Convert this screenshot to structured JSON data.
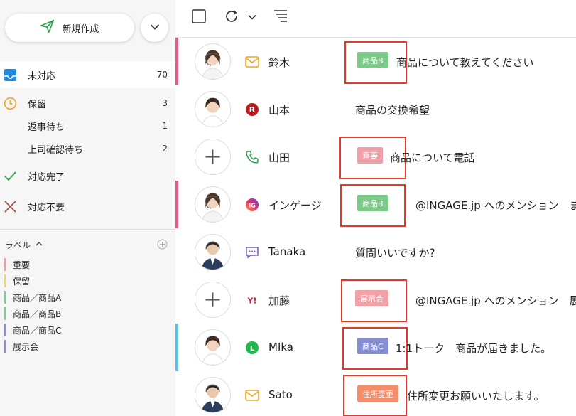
{
  "sidebar": {
    "compose_label": "新規作成",
    "nav": [
      {
        "label": "未対応",
        "count": "70"
      },
      {
        "label": "保留",
        "count": "3"
      },
      {
        "label": "返事待ち",
        "count": "1"
      },
      {
        "label": "上司確認待ち",
        "count": "2"
      },
      {
        "label": "対応完了",
        "count": ""
      },
      {
        "label": "対応不要",
        "count": ""
      }
    ],
    "labels_heading": "ラベル",
    "labels": [
      {
        "name": "重要",
        "color": "#f19aa2"
      },
      {
        "name": "保留",
        "color": "#f5d36a"
      },
      {
        "name": "商品／商品A",
        "color": "#7bcf8a"
      },
      {
        "name": "商品／商品B",
        "color": "#7bcf8a"
      },
      {
        "name": "商品／商品C",
        "color": "#8a8fd6"
      },
      {
        "name": "展示会",
        "color": "#8a8fd6"
      }
    ]
  },
  "messages": [
    {
      "sender": "鈴木",
      "channel": "mail-icon",
      "tag": "商品B",
      "tag_color": "#7cc989",
      "subject": "商品について教えてください",
      "accent": "#ea5a86",
      "avatar": "operator-woman"
    },
    {
      "sender": "山本",
      "channel": "r-icon",
      "tag": "",
      "tag_color": "",
      "subject": "商品の交換希望",
      "accent": "",
      "avatar": "woman"
    },
    {
      "sender": "山田",
      "channel": "phone-icon",
      "tag": "重要",
      "tag_color": "#f0a0a6",
      "subject": "商品について電話",
      "accent": "",
      "avatar": "plus"
    },
    {
      "sender": "インゲージ",
      "channel": "instagram-icon",
      "tag": "商品B",
      "tag_color": "#7cc989",
      "subject": "@INGAGE.jp へのメンション　まだ",
      "accent": "#ea5a86",
      "avatar": "operator-woman"
    },
    {
      "sender": "Tanaka",
      "channel": "chat-icon",
      "tag": "",
      "tag_color": "",
      "subject": "質問いいですか？",
      "accent": "",
      "avatar": "operator-man"
    },
    {
      "sender": "加藤",
      "channel": "yahoo-icon",
      "tag": "展示会",
      "tag_color": "#f0a0a6",
      "subject": "@INGAGE.jp へのメンション　展示",
      "accent": "",
      "avatar": "plus"
    },
    {
      "sender": "MIka",
      "channel": "line-icon",
      "tag": "商品C",
      "tag_color": "#858dd3",
      "subject": "1:1トーク　商品が届きました。",
      "accent": "#5bbdf0",
      "avatar": "woman"
    },
    {
      "sender": "Sato",
      "channel": "mail-icon",
      "tag": "住所変更",
      "tag_color": "#f58c6a",
      "subject": "住所変更お願いいたします。",
      "accent": "",
      "avatar": "operator-man"
    }
  ]
}
